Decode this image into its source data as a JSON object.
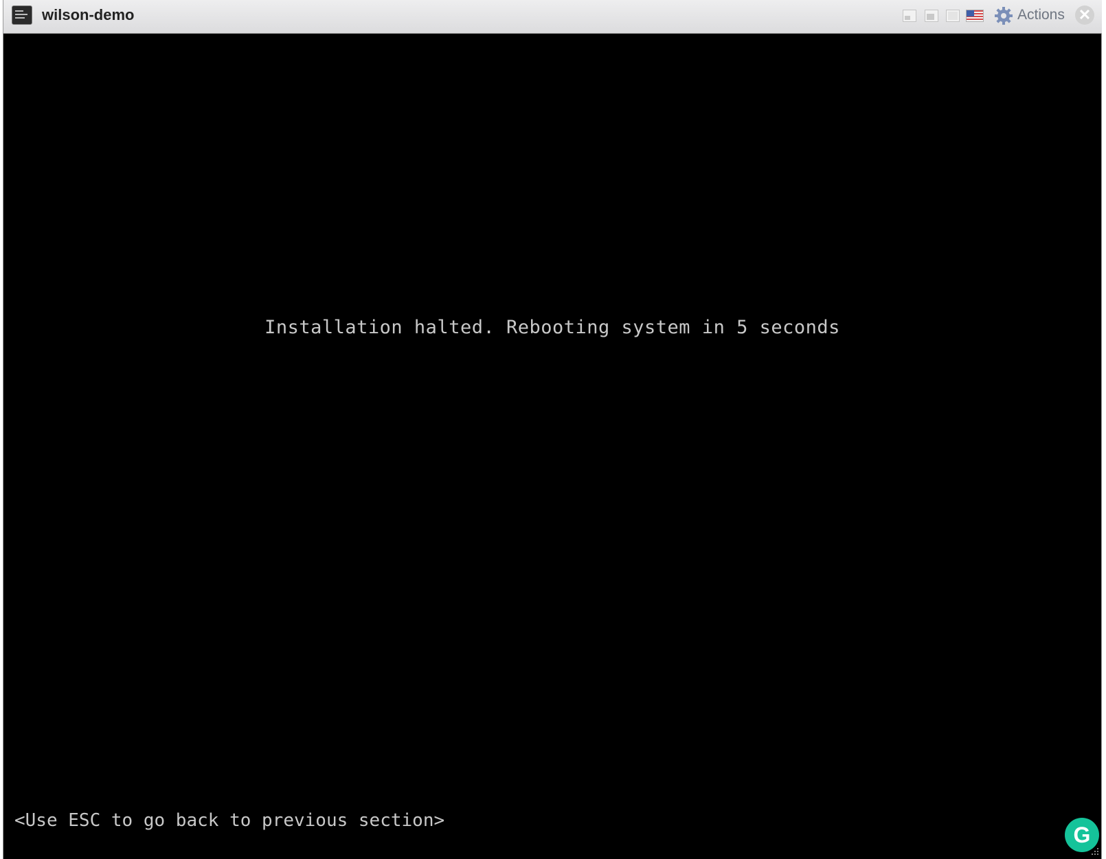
{
  "window": {
    "title": "wilson-demo",
    "icon": "console-icon"
  },
  "toolbar": {
    "buttons": [
      {
        "name": "view-small",
        "icon": "window-small-icon"
      },
      {
        "name": "view-medium",
        "icon": "window-medium-icon"
      },
      {
        "name": "view-large",
        "icon": "window-large-icon"
      }
    ],
    "keyboard_flag_icon": "us-flag-icon",
    "actions_icon": "gear-icon",
    "actions_label": "Actions",
    "close_icon": "close-icon",
    "close_glyph": "✕"
  },
  "console": {
    "message": "Installation halted. Rebooting system in 5 seconds",
    "hint": "<Use ESC to go back to previous section>",
    "background_color": "#000000",
    "text_color": "#c8c8c8"
  },
  "overlay": {
    "grammarly_glyph": "G",
    "grammarly_color": "#15c39a"
  }
}
